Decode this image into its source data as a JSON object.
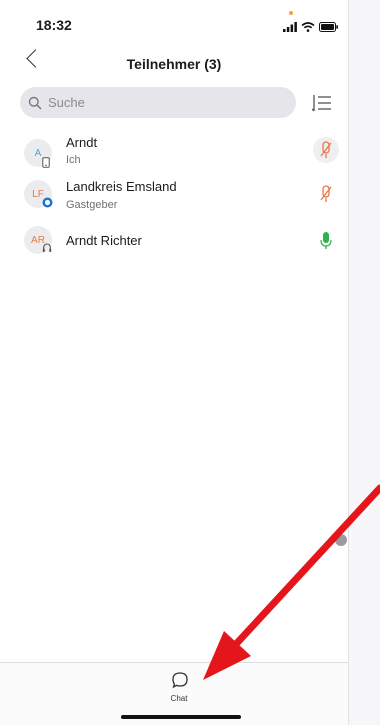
{
  "status_bar": {
    "time": "18:32",
    "icons": [
      "signal-icon",
      "wifi-icon",
      "battery-icon"
    ]
  },
  "header": {
    "back_icon": "chevron-left-icon",
    "title": "Teilnehmer (3)"
  },
  "search": {
    "placeholder": "Suche",
    "sort_icon": "sort-list-icon"
  },
  "participants": [
    {
      "initials": "A",
      "name": "Arndt",
      "role": "Ich",
      "badge": "phone-icon",
      "initials_color": "#4aa3d8",
      "mic": "muted-mic-icon",
      "mic_color": "#e8774a"
    },
    {
      "initials": "LF",
      "name": "Landkreis Emsland",
      "role": "Gastgeber",
      "badge": "app-icon",
      "initials_color": "#e8774a",
      "mic": "muted-mic-icon",
      "mic_color": "#e8774a"
    },
    {
      "initials": "AR",
      "name": "Arndt Richter",
      "role": "",
      "badge": "headset-icon",
      "initials_color": "#e8774a",
      "mic": "active-mic-icon",
      "mic_color": "#2fb34a"
    }
  ],
  "bottom_bar": {
    "chat_label": "Chat",
    "chat_icon": "chat-bubble-icon"
  },
  "annotation": {
    "color": "#e4161b"
  }
}
